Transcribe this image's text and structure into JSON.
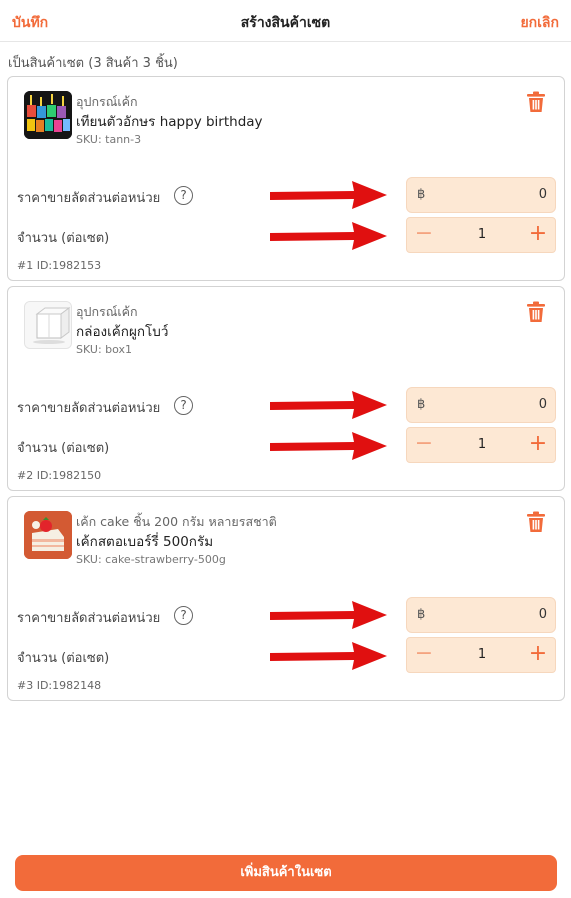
{
  "header": {
    "save": "บันทึก",
    "title": "สร้างสินค้าเซต",
    "cancel": "ยกเลิก"
  },
  "set_summary": "เป็นสินค้าเซต (3 สินค้า 3 ชิ้น)",
  "labels": {
    "discount_price": "ราคาขายลัดส่วนต่อหน่วย",
    "quantity": "จำนวน (ต่อเซต)",
    "currency": "฿",
    "help": "?",
    "minus": "−",
    "plus": "+"
  },
  "items": [
    {
      "category": "อุปกรณ์เค้ก",
      "name": "เทียนตัวอักษร happy birthday",
      "sku": "SKU: tann-3",
      "price": "0",
      "qty": "1",
      "row_id": "#1 ID:1982153",
      "thumb_letters": "HAPPY BIRTH"
    },
    {
      "category": "อุปกรณ์เค้ก",
      "name": "กล่องเค้กผูกโบว์",
      "sku": "SKU: box1",
      "price": "0",
      "qty": "1",
      "row_id": "#2 ID:1982150"
    },
    {
      "category": "เค้ก cake ชิ้น 200 กรัม หลายรสชาติ",
      "name": "เค้กสตอเบอร์รี่ 500กรัม",
      "sku": "SKU: cake-strawberry-500g",
      "price": "0",
      "qty": "1",
      "row_id": "#3 ID:1982148"
    }
  ],
  "add_button": "เพิ่มสินค้าในเซต",
  "colors": {
    "accent": "#f26b3a",
    "field_bg": "#fde8d4",
    "arrow": "#e01010"
  },
  "icons": [
    "trash-icon",
    "help-icon",
    "arrow-annotation"
  ]
}
